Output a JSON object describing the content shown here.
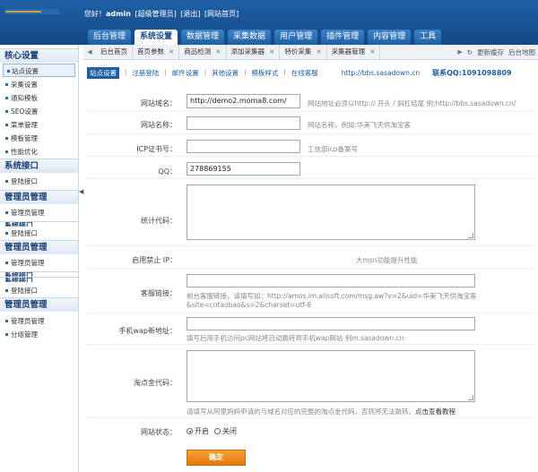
{
  "header": {
    "welcome_prefix": "您好！",
    "username": "admin",
    "role": "[超级管理员]",
    "logout": "[退出]",
    "home": "[网站首页]"
  },
  "nav": [
    "后台管理",
    "系统设置",
    "数据管理",
    "采集数据",
    "用户管理",
    "插件管理",
    "内容管理",
    "工具"
  ],
  "nav_active": 1,
  "sidebar": {
    "sec_core": "核心设置",
    "core_items": [
      "站点设置",
      "采集设置",
      "通知模板",
      "SEO设置",
      "菜单管理",
      "模板管理",
      "性能优化"
    ],
    "sec_login": "系统接口",
    "login_item": "登陆接口",
    "sec_admin1": "管理员管理",
    "admin_item1": "管理员管理",
    "trunc1": "系统接口",
    "login_item2": "登陆接口",
    "sec_admin2": "管理员管理",
    "admin_item2": "管理员管理",
    "trunc2": "系统接口",
    "trunc3": "系统接口",
    "login_item3": "登陆接口",
    "sec_admin3": "管理员管理",
    "admin_item3": "管理员管理",
    "group_item": "分组管理"
  },
  "tabs": [
    "后台首页",
    "首页参数",
    "商品检测",
    "添加采集器",
    "特价采集",
    "采集器管理"
  ],
  "tab_tools": {
    "refresh": "↻",
    "fav": "更新缓存",
    "home": "后台地图"
  },
  "subnav": {
    "items": [
      "站点设置",
      "注册登陆",
      "邮件设置",
      "其他设置",
      "模板样式",
      "在线客服"
    ],
    "site_url": "http://bbs.sasadown.cn",
    "qq": "联系QQ:1091098809"
  },
  "form": {
    "domain_label": "网站域名：",
    "domain_value": "http://demo2.moma8.com/",
    "domain_hint": "网站地址必须以http:// 开头 / 斜杠结尾 例:http://bbs.sasadown.cn/",
    "name_label": "网站名称：",
    "name_value": "",
    "name_hint": "网站名称，例如:华美飞天供淘宝客",
    "icp_label": "ICP证书号：",
    "icp_value": "",
    "icp_hint": "工信部icp备案号",
    "qq_label": "QQ：",
    "qq_value": "278869155",
    "stat_label": "统计代码：",
    "ip_label": "启用禁止 IP：",
    "ip_hint": "大msn功能提升性能",
    "service_label": "客服链接：",
    "service_hint1": "前台客服链接，请填写如：http://amos.im.alisoft.com/msg.aw?v=2&uid=华美飞天供淘宝客",
    "service_hint2": "&site=cntaobao&s=2&charset=utf-8",
    "wap_label": "手机wap新地址：",
    "wap_hint": "填写后用手机访问pc网站将自动跳转到手机wap网站 例m.sasadown.cn",
    "taoke_label": "淘点金代码：",
    "taoke_hint": "请填写从阿里妈妈申请的与域名对应的完整的淘点金代码，否则将无法跳转。",
    "taoke_link": "点击查看教程",
    "status_label": "网站状态：",
    "status_on": "开启",
    "status_off": "关闭",
    "submit": "确定"
  }
}
